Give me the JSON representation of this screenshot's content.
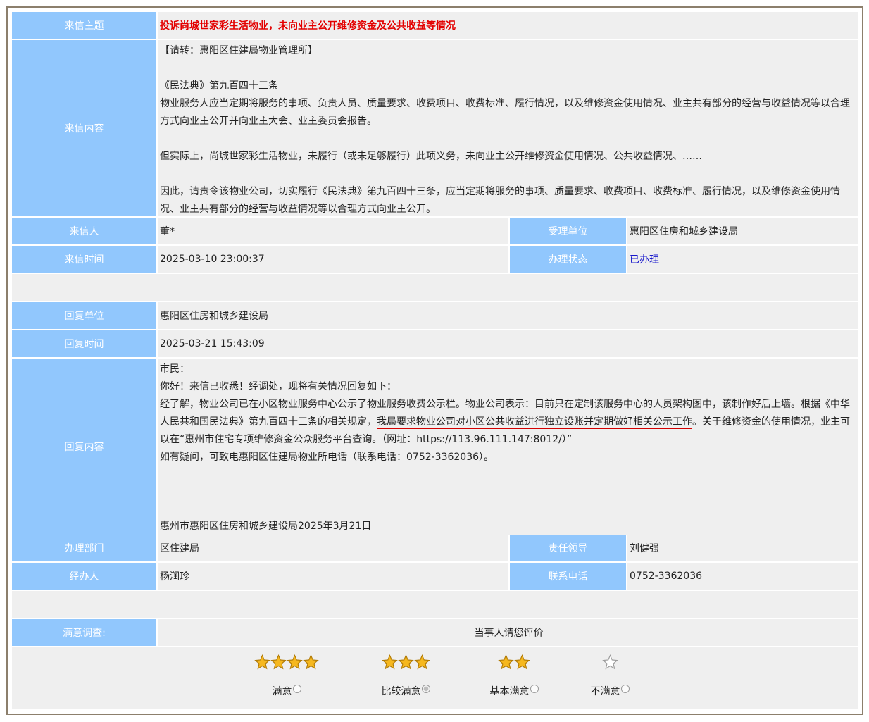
{
  "letter": {
    "subject_label": "来信主题",
    "subject": "投诉尚城世家彩生活物业，未向业主公开维修资金及公共收益等情况",
    "content_label": "来信内容",
    "content": "【请转：惠阳区住建局物业管理所】\n\n《民法典》第九百四十三条\n物业服务人应当定期将服务的事项、负责人员、质量要求、收费项目、收费标准、履行情况，以及维修资金使用情况、业主共有部分的经营与收益情况等以合理方式向业主公开并向业主大会、业主委员会报告。\n\n但实际上，尚城世家彩生活物业，未履行（或未足够履行）此项义务，未向业主公开维修资金使用情况、公共收益情况、……\n\n因此，请责令该物业公司，切实履行《民法典》第九百四十三条，应当定期将服务的事项、质量要求、收费项目、收费标准、履行情况，以及维修资金使用情况、业主共有部分的经营与收益情况等以合理方式向业主公开。",
    "writer_label": "来信人",
    "writer": "董*",
    "handler_unit_label": "受理单位",
    "handler_unit": "惠阳区住房和城乡建设局",
    "time_label": "来信时间",
    "time": "2025-03-10 23:00:37",
    "status_label": "办理状态",
    "status": "已办理"
  },
  "reply": {
    "unit_label": "回复单位",
    "unit": "惠阳区住房和城乡建设局",
    "time_label": "回复时间",
    "time": "2025-03-21 15:43:09",
    "content_label": "回复内容",
    "content_before": "市民：\n你好！来信已收悉！经调处，现将有关情况回复如下：\n经了解，物业公司已在小区物业服务中心公示了物业服务收费公示栏。物业公司表示：目前只在定制该服务中心的人员架构图中，该制作好后上墙。根据《中华人民共和国民法典》第九百四十三条的相关规定，",
    "content_highlight": "我局要求物业公司对小区公共收益进行独立设账并定期做好相关公示工作",
    "content_after": "。关于维修资金的使用情况，业主可以在“惠州市住宅专项维修资金公众服务平台查询。（网址：https://113.96.111.147:8012/）”\n如有疑问，可致电惠阳区住建局物业所电话（联系电话：0752-3362036）。",
    "signature": "惠州市惠阳区住房和城乡建设局2025年3月21日",
    "dept_label": "办理部门",
    "dept": "区住建局",
    "leader_label": "责任领导",
    "leader": "刘健强",
    "officer_label": "经办人",
    "officer": "杨润珍",
    "phone_label": "联系电话",
    "phone": "0752-3362036"
  },
  "survey": {
    "label": "满意调查:",
    "prompt": "当事人请您评价",
    "options": [
      {
        "label": "满意",
        "stars": 4,
        "checked": false
      },
      {
        "label": "比较满意",
        "stars": 3,
        "checked": true
      },
      {
        "label": "基本满意",
        "stars": 2,
        "checked": false
      },
      {
        "label": "不满意",
        "stars": 0,
        "checked": false
      }
    ],
    "star_color": "#f6b81f"
  }
}
